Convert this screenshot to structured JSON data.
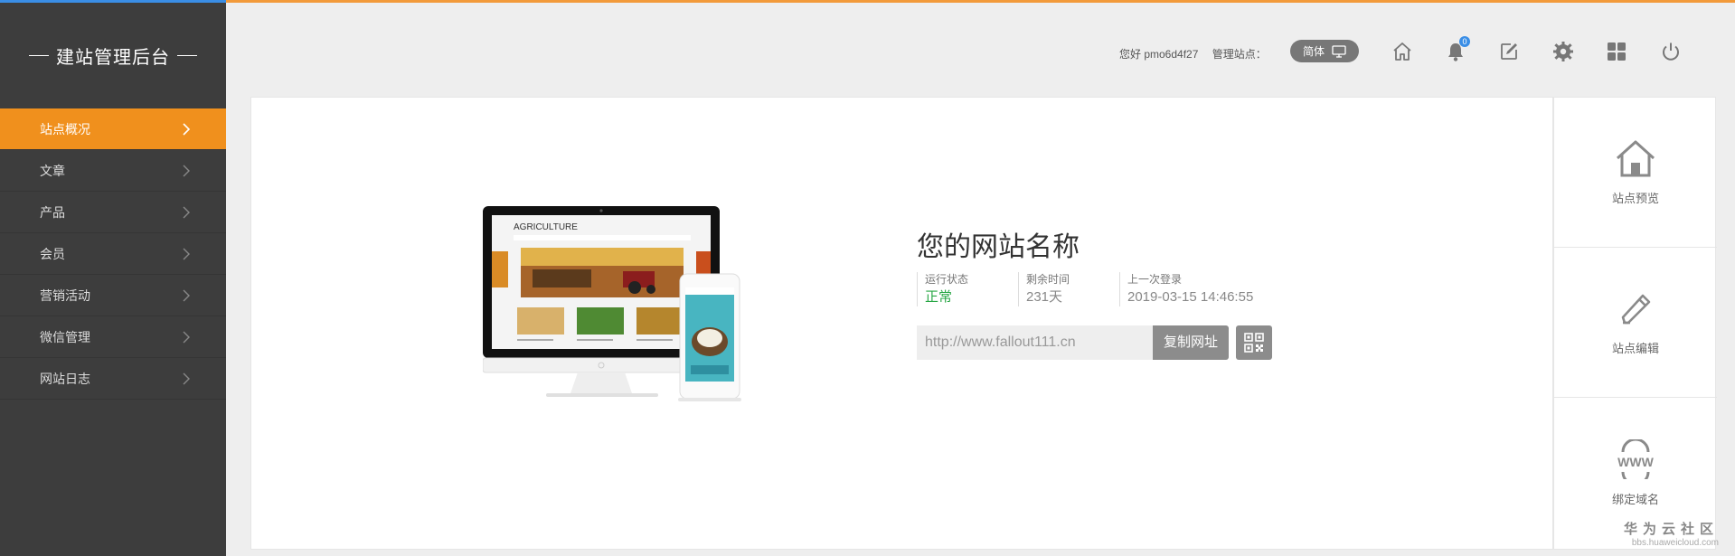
{
  "brand": {
    "title": "建站管理后台"
  },
  "sidebar": {
    "items": [
      {
        "label": "站点概况",
        "active": true
      },
      {
        "label": "文章"
      },
      {
        "label": "产品"
      },
      {
        "label": "会员"
      },
      {
        "label": "营销活动"
      },
      {
        "label": "微信管理"
      },
      {
        "label": "网站日志"
      }
    ]
  },
  "header": {
    "greeting": "您好 pmo6d4f27",
    "manage_label": "管理站点：",
    "lang_label": "简体",
    "notification_count": "0",
    "icons": [
      "home-icon",
      "bell-icon",
      "edit-icon",
      "gear-icon",
      "apps-icon",
      "power-icon"
    ]
  },
  "mockup": {
    "brand_text": "AGRICULTURE"
  },
  "site": {
    "name": "您的网站名称",
    "status_label": "运行状态",
    "status_value": "正常",
    "remaining_label": "剩余时间",
    "remaining_value": "231天",
    "lastlogin_label": "上一次登录",
    "lastlogin_value": "2019-03-15 14:46:55",
    "url": "http://www.fallout111.cn",
    "copy_label": "复制网址"
  },
  "quick": {
    "preview_label": "站点预览",
    "edit_label": "站点编辑",
    "domain_label": "绑定域名",
    "domain_icon_text": "WWW"
  },
  "watermark": {
    "line1": "华为云社区",
    "line2": "bbs.huaweicloud.com"
  },
  "colors": {
    "accent": "#f0901d",
    "sidebar": "#3d3d3d",
    "ok": "#28a745",
    "topbar_blue": "#3a8ee6",
    "topbar_orange": "#f29a3a"
  }
}
